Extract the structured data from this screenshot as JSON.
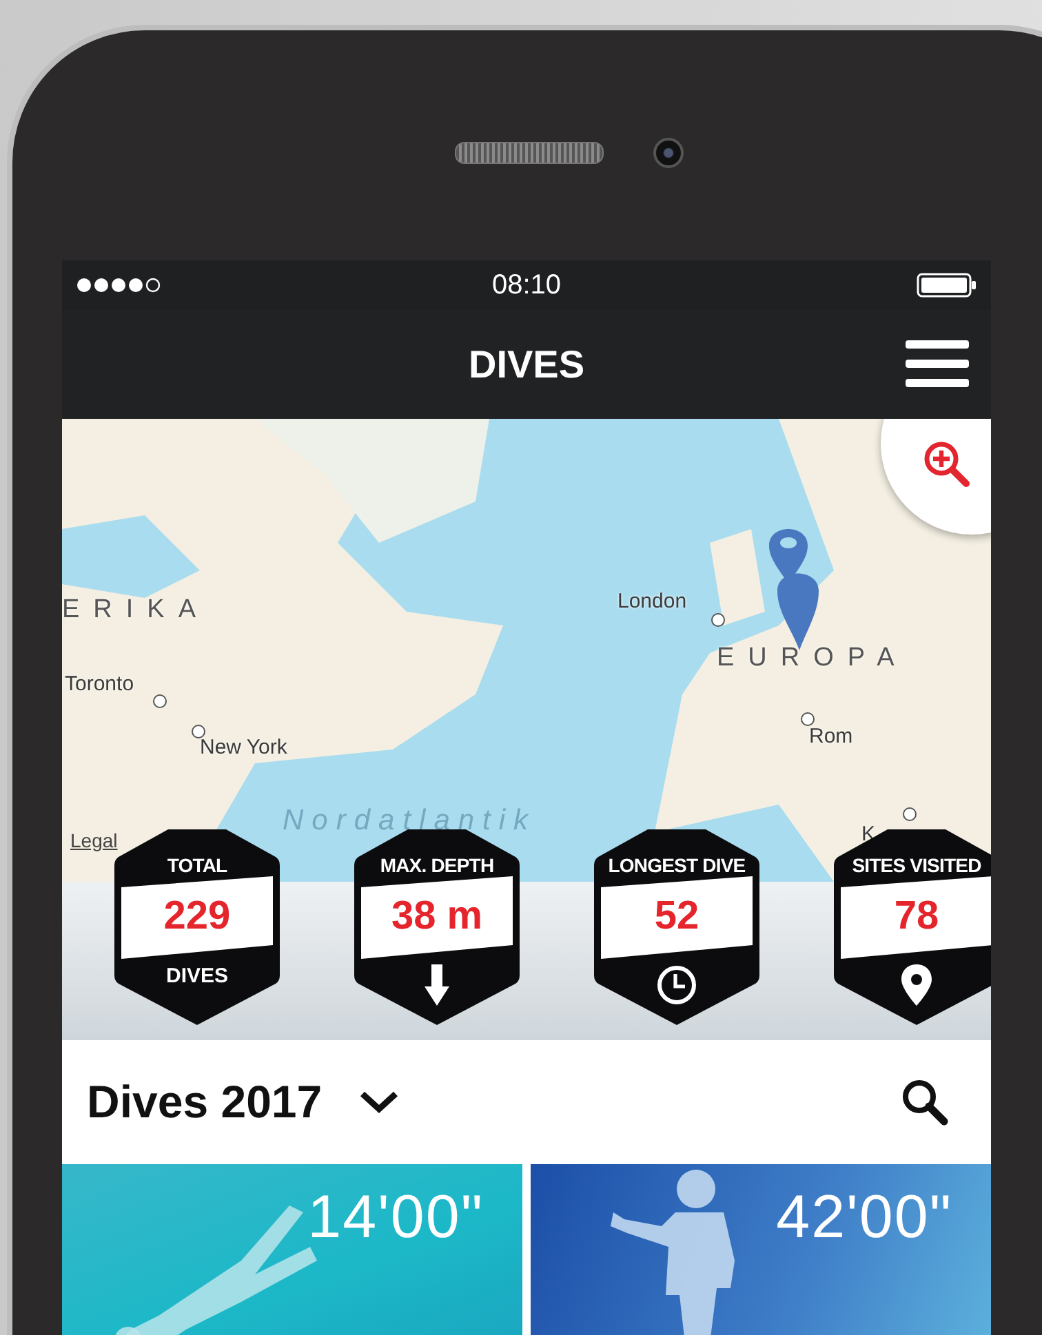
{
  "status_bar": {
    "time": "08:10"
  },
  "nav": {
    "title": "DIVES"
  },
  "map": {
    "labels": [
      {
        "text": "ERIKA",
        "kind": "region"
      },
      {
        "text": "Toronto",
        "kind": "city"
      },
      {
        "text": "New York",
        "kind": "city"
      },
      {
        "text": "London",
        "kind": "city"
      },
      {
        "text": "EUROPA",
        "kind": "region"
      },
      {
        "text": "Rom",
        "kind": "city"
      },
      {
        "text": "Nordatlantik",
        "kind": "ocean"
      },
      {
        "text": "K",
        "kind": "city"
      }
    ],
    "legal": "Legal"
  },
  "stats": [
    {
      "title": "TOTAL",
      "value": "229",
      "footer": "DIVES",
      "kind": "count"
    },
    {
      "title": "MAX. DEPTH",
      "value": "38 m",
      "kind": "depth"
    },
    {
      "title": "LONGEST DIVE",
      "value": "52",
      "kind": "time"
    },
    {
      "title": "SITES VISITED",
      "value": "78",
      "kind": "sites"
    }
  ],
  "list": {
    "title": "Dives 2017"
  },
  "dives": [
    {
      "duration": "14'00\"",
      "kind": "swimming"
    },
    {
      "duration": "42'00\"",
      "kind": "standing"
    }
  ]
}
